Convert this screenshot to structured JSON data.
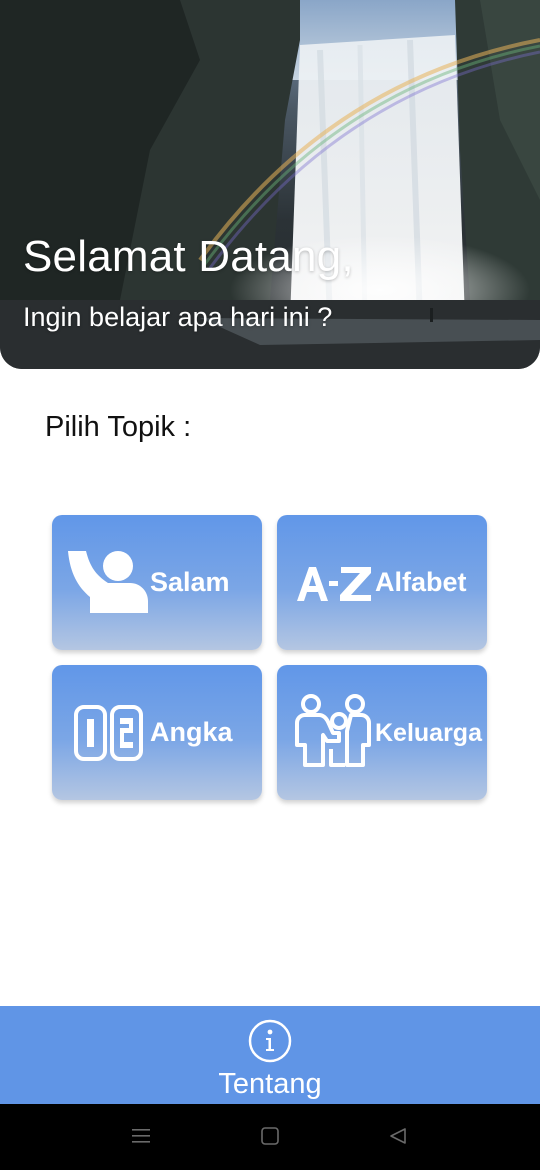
{
  "hero": {
    "title": "Selamat Datang,",
    "subtitle": "Ingin belajar apa hari ini ?"
  },
  "section": {
    "title": "Pilih Topik :"
  },
  "topics": [
    {
      "label": "Salam",
      "icon": "greeting-person-icon"
    },
    {
      "label": "Alfabet",
      "icon": "a-z-icon"
    },
    {
      "label": "Angka",
      "icon": "numbers-icon"
    },
    {
      "label": "Keluarga",
      "icon": "family-icon"
    }
  ],
  "bottom_nav": {
    "label": "Tentang",
    "icon": "info-icon"
  },
  "system_nav": {
    "icons": [
      "menu-icon",
      "home-square-icon",
      "back-triangle-icon"
    ]
  },
  "colors": {
    "card_top": "#6197e8",
    "card_bottom": "#b4c6e2",
    "bottom_bar": "#6095e6",
    "text_dark": "#111111"
  }
}
